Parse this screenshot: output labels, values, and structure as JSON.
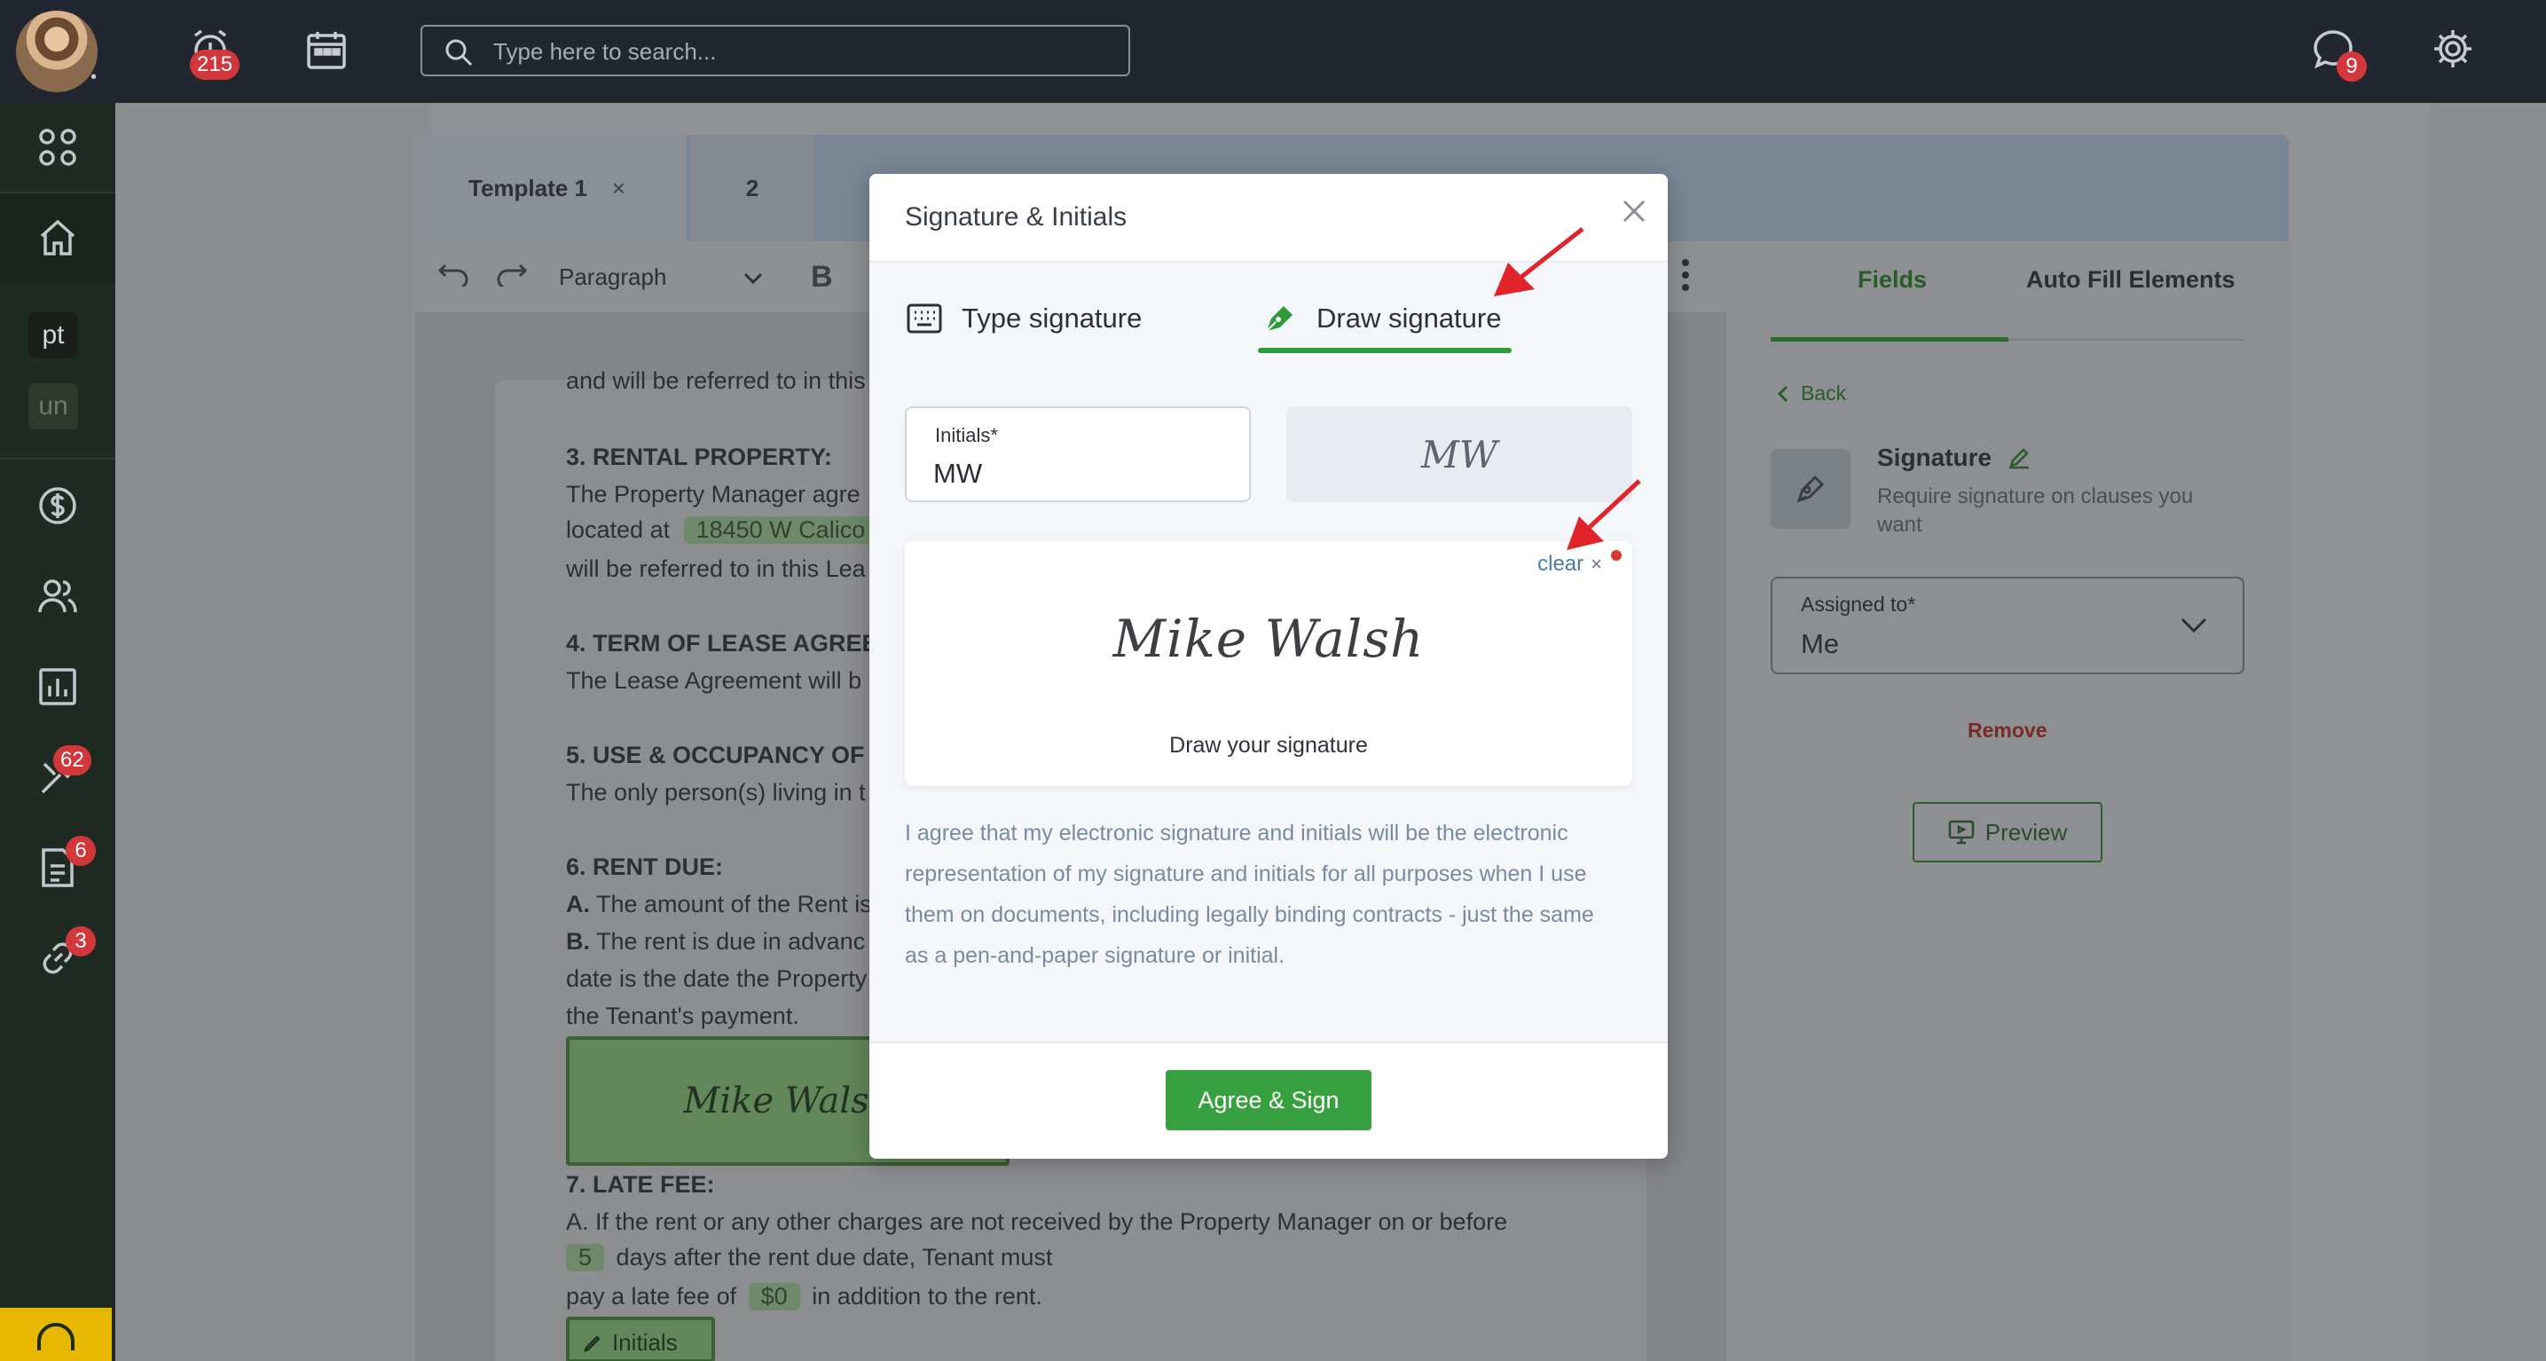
{
  "topbar": {
    "alarm_badge": "215",
    "chat_badge": "9",
    "search_placeholder": "Type here to search..."
  },
  "sidebar": {
    "chip_pt": "pt",
    "chip_un": "un",
    "maintenance_badge": "62",
    "documents_badge": "6",
    "links_badge": "3"
  },
  "editor": {
    "tabs": [
      {
        "label": "Template 1",
        "close": "×"
      },
      {
        "label": "2"
      }
    ],
    "toolbar": {
      "block_type": "Paragraph",
      "bold": "B"
    },
    "doc": {
      "line0": "and will be referred to in this",
      "s3_heading": "3. RENTAL PROPERTY:",
      "s3_line1": "The Property Manager agre",
      "s3_line2_pre": "located at",
      "s3_address": "18450 W Calico",
      "s3_line3": "will be referred to in this Lea",
      "s4_heading": "4. TERM OF LEASE AGREE",
      "s4_line1": "The Lease Agreement will b",
      "s5_heading": "5. USE & OCCUPANCY OF",
      "s5_line1": "The only person(s) living in t",
      "s6_heading": "6. RENT DUE:",
      "s6_a_label": "A.",
      "s6_a_text": "The amount of the Rent is",
      "s6_b_label": "B.",
      "s6_b_text": "The rent is due in advanc",
      "s6_line3": "date is the date the Property",
      "s6_line4": "the Tenant's payment.",
      "signature": "Mike Walsh",
      "s7_heading": "7. LATE FEE:",
      "s7_line1": "A. If the rent or any other charges are not received by the Property Manager on or before",
      "s7_days": "5",
      "s7_line2": "days after the rent due date, Tenant must",
      "s7_line3_pre": "pay a late fee of",
      "s7_fee": "$0",
      "s7_line3_post": "in addition to the rent.",
      "initials_field": "Initials"
    }
  },
  "right_panel": {
    "tab_fields": "Fields",
    "tab_autofill": "Auto Fill Elements",
    "back": "Back",
    "signature_title": "Signature",
    "signature_desc_1": "Require signature on clauses you",
    "signature_desc_2": "want",
    "assigned_label": "Assigned to*",
    "assigned_value": "Me",
    "remove": "Remove",
    "preview": "Preview"
  },
  "modal": {
    "title": "Signature & Initials",
    "tab_type": "Type signature",
    "tab_draw": "Draw signature",
    "initials_label": "Initials*",
    "initials_value": "MW",
    "initials_preview": "MW",
    "clear": "clear",
    "drawn_signature": "Mike Walsh",
    "draw_caption": "Draw your signature",
    "consent_1": "I agree that my electronic signature and initials will be the electronic",
    "consent_2": "representation of my signature and initials for all purposes when I use",
    "consent_3": "them on documents, including legally binding contracts - just the same",
    "consent_4": "as a pen-and-paper signature or initial.",
    "agree_button": "Agree & Sign"
  },
  "colors": {
    "accent_green": "#37a13f",
    "annotation_red": "#e0242a",
    "badge_red": "#d2373c"
  }
}
